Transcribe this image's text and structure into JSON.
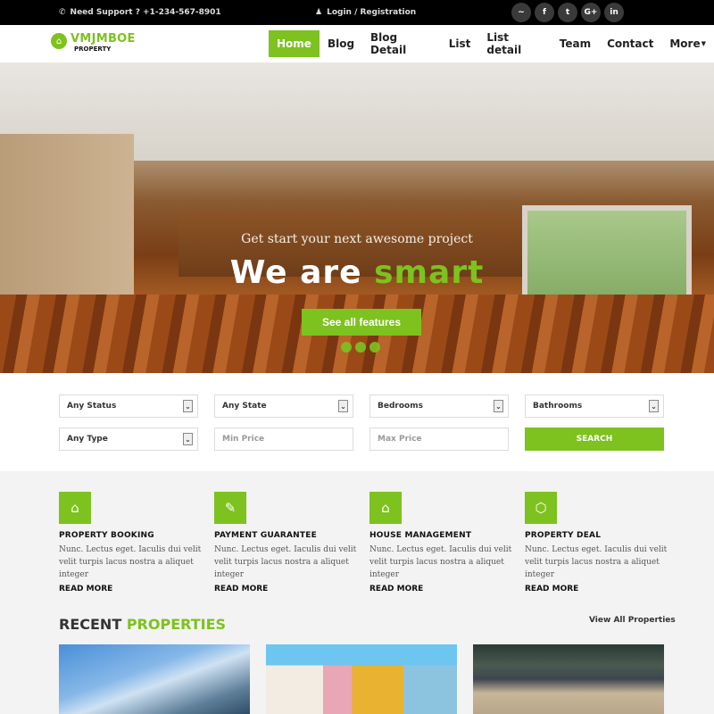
{
  "topbar": {
    "support_text": "Need Support ? +1-234-567-8901",
    "login_text": "Login / Registration",
    "social": [
      {
        "icon": "rss-icon",
        "glyph": ")"
      },
      {
        "icon": "facebook-icon",
        "glyph": "f"
      },
      {
        "icon": "twitter-icon",
        "glyph": "t"
      },
      {
        "icon": "google-plus-icon",
        "glyph": "G+"
      },
      {
        "icon": "linkedin-icon",
        "glyph": "in"
      }
    ]
  },
  "header": {
    "logo_name": "VMJMBOE",
    "logo_sub": "PROPERTY",
    "nav": [
      "Home",
      "Blog",
      "Blog Detail",
      "List",
      "List detail",
      "Team",
      "Contact",
      "More"
    ],
    "active_nav": "Home"
  },
  "hero": {
    "tagline": "Get start your next awesome project",
    "headline_white": "We are",
    "headline_green": "smart",
    "cta": "See all features",
    "slides": 3
  },
  "search": {
    "status": "Any Status",
    "state": "Any State",
    "bedrooms": "Bedrooms",
    "bathrooms": "Bathrooms",
    "type": "Any Type",
    "min_price_placeholder": "Min Price",
    "max_price_placeholder": "Max Price",
    "button": "SEARCH"
  },
  "features": [
    {
      "icon": "home-icon",
      "title": "PROPERTY BOOKING",
      "text": "Nunc. Lectus eget. Iaculis dui velit velit turpis lacus nostra a aliquet integer",
      "link": "READ MORE"
    },
    {
      "icon": "pencil-icon",
      "title": "PAYMENT GUARANTEE",
      "text": "Nunc. Lectus eget. Iaculis dui velit velit turpis lacus nostra a aliquet integer",
      "link": "READ MORE"
    },
    {
      "icon": "home-icon",
      "title": "HOUSE MANAGEMENT",
      "text": "Nunc. Lectus eget. Iaculis dui velit velit turpis lacus nostra a aliquet integer",
      "link": "READ MORE"
    },
    {
      "icon": "geodesic-icon",
      "title": "PROPERTY DEAL",
      "text": "Nunc. Lectus eget. Iaculis dui velit velit turpis lacus nostra a aliquet integer",
      "link": "READ MORE"
    }
  ],
  "recent": {
    "title_dark": "RECENT",
    "title_green": "PROPERTIES",
    "view_all": "View All Properties"
  },
  "colors": {
    "accent": "#7dc21e",
    "topbar": "#000000",
    "section_bg": "#f3f3f3"
  }
}
